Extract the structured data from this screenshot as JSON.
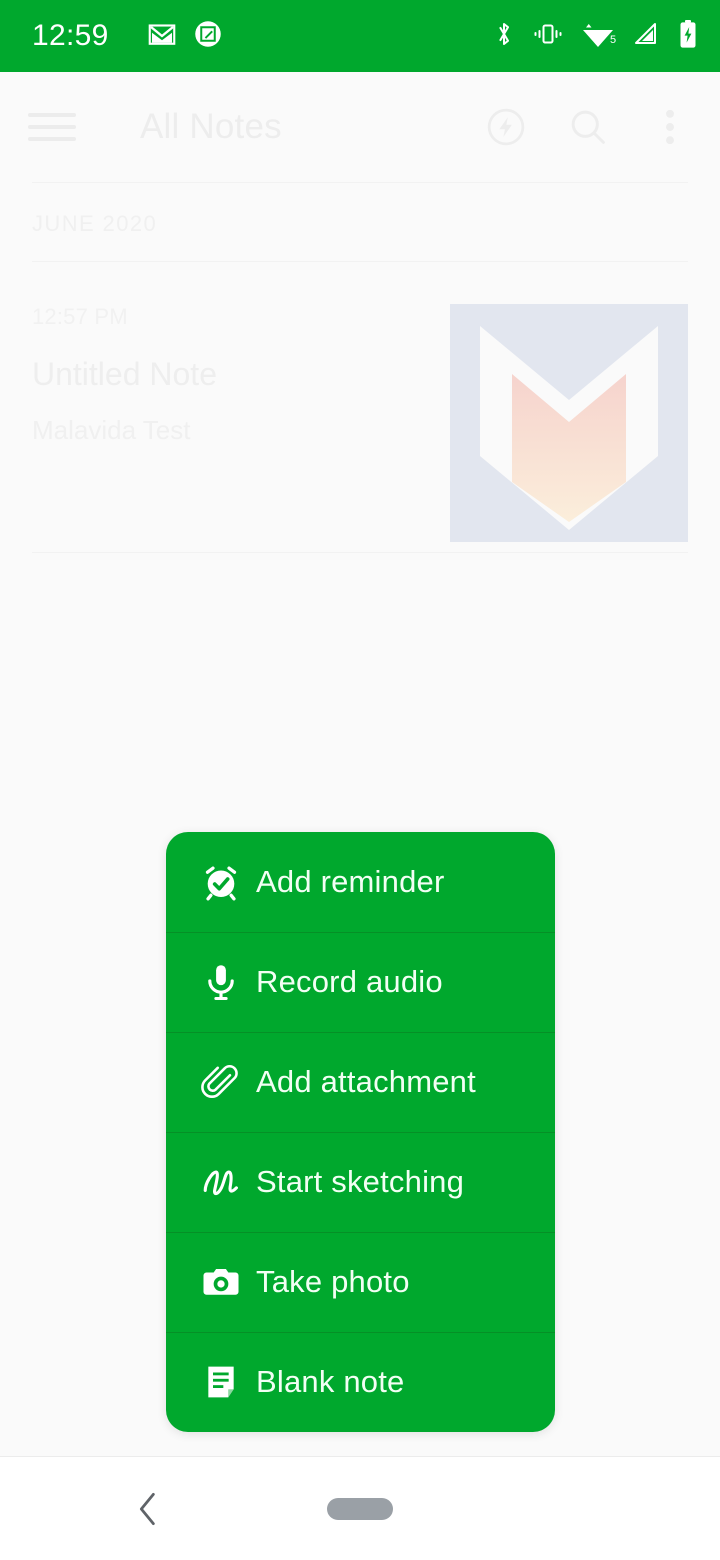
{
  "status_bar": {
    "time": "12:59",
    "left_icons": [
      "gmail-icon",
      "screenshot-edit-icon"
    ],
    "right_icons": [
      "bluetooth-icon",
      "vibrate-icon",
      "wifi-icon",
      "signal-icon",
      "battery-charging-icon"
    ],
    "wifi_badge": "5",
    "background_color": "#00a82d"
  },
  "app_bar": {
    "menu_label": "menu",
    "title": "All Notes",
    "actions": [
      {
        "name": "quick-note-icon",
        "label": "Quick note"
      },
      {
        "name": "search-icon",
        "label": "Search"
      },
      {
        "name": "overflow-menu-icon",
        "label": "More options"
      }
    ]
  },
  "notes": {
    "month_header": "JUNE 2020",
    "items": [
      {
        "time": "12:57 PM",
        "title": "Untitled Note",
        "snippet": "Malavida Test",
        "thumbnail": "malavida-logo-thumbnail"
      }
    ]
  },
  "action_menu": {
    "background_color": "#00a82d",
    "divider_color": "#059026",
    "text_color": "#f2fff4",
    "items": [
      {
        "icon": "alarm-check-icon",
        "label": "Add reminder"
      },
      {
        "icon": "microphone-icon",
        "label": "Record audio"
      },
      {
        "icon": "paperclip-icon",
        "label": "Add attachment"
      },
      {
        "icon": "squiggle-icon",
        "label": "Start sketching"
      },
      {
        "icon": "camera-icon",
        "label": "Take photo"
      },
      {
        "icon": "note-icon",
        "label": "Blank note"
      }
    ]
  },
  "nav_bar": {
    "back_label": "Back",
    "home_label": "Home"
  }
}
